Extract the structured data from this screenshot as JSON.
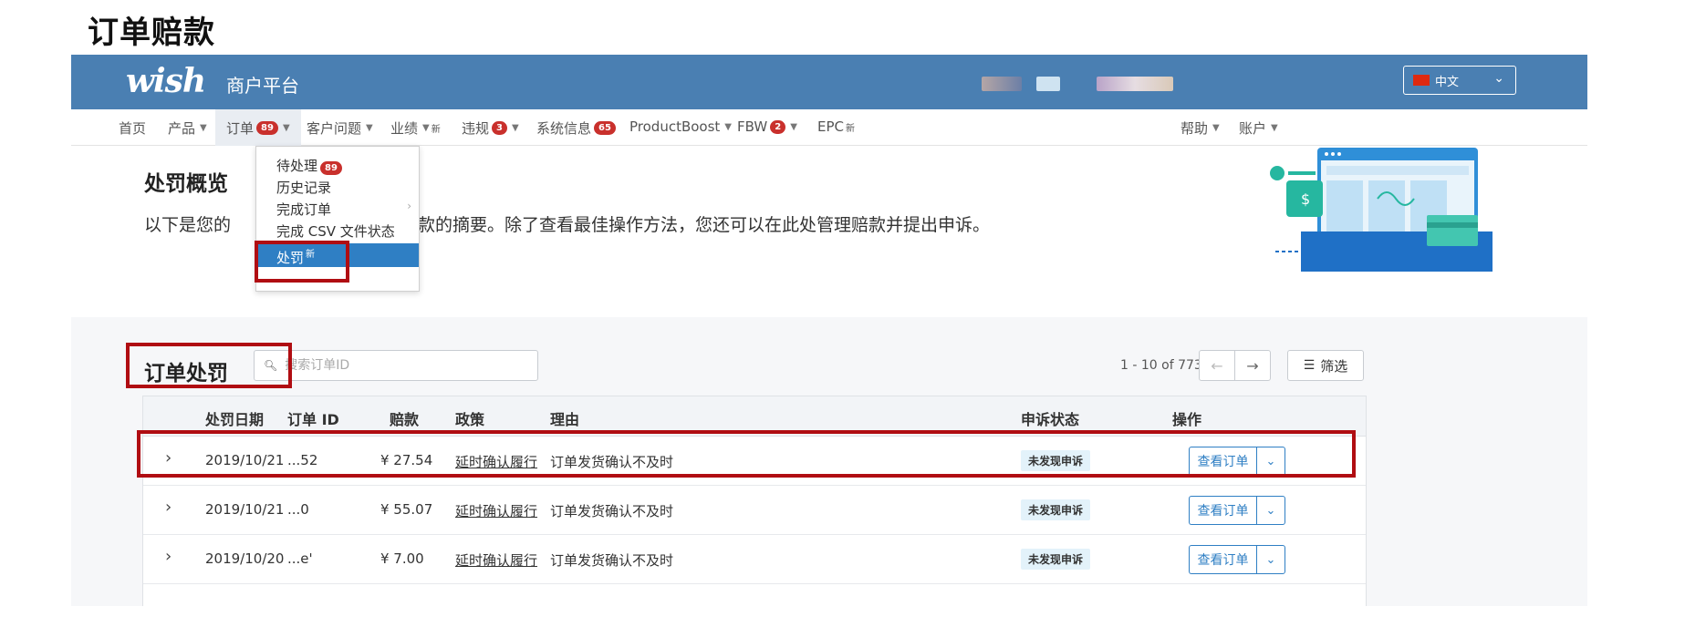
{
  "doc_heading": "订单赔款",
  "header": {
    "logo": "wish",
    "platform": "商户平台",
    "language": "中文",
    "colors": {
      "bar": "#4a7fb2",
      "accent": "#2f7fc4",
      "highlight_box": "#b00d12"
    }
  },
  "nav": {
    "home": "首页",
    "products": "产品",
    "orders": "订单",
    "orders_badge": "89",
    "customer": "客户问题",
    "performance": "业绩",
    "performance_new": "新",
    "violations": "违规",
    "violations_badge": "3",
    "system": "系统信息",
    "system_badge": "65",
    "productboost": "ProductBoost",
    "fbw": "FBW",
    "fbw_badge": "2",
    "epc": "EPC",
    "epc_new": "新",
    "help": "帮助",
    "account": "账户"
  },
  "orders_menu": {
    "pending": "待处理",
    "pending_badge": "89",
    "history": "历史记录",
    "completed": "完成订单",
    "csv_status": "完成 CSV 文件状态",
    "penalty": "处罚",
    "penalty_new": "新"
  },
  "overview": {
    "title": "处罚概览",
    "desc_left": "以下是您的",
    "desc_right": "处以赔款的摘要。除了查看最佳操作方法，您还可以在此处管理赔款并提出申诉。"
  },
  "penalties": {
    "title": "订单处罚",
    "search_placeholder": "搜索订单ID",
    "pagination": "1 - 10 of 773",
    "filter_label": "筛选",
    "columns": [
      "处罚日期",
      "订单 ID",
      "赔款",
      "政策",
      "理由",
      "申诉状态",
      "操作"
    ],
    "rows": [
      {
        "date": "2019/10/21",
        "order_id": "...52",
        "amount": "¥ 27.54",
        "policy": "延时确认履行",
        "reason": "订单发货确认不及时",
        "appeal": "未发现申诉",
        "view": "查看订单"
      },
      {
        "date": "2019/10/21",
        "order_id": "...0",
        "amount": "¥ 55.07",
        "policy": "延时确认履行",
        "reason": "订单发货确认不及时",
        "appeal": "未发现申诉",
        "view": "查看订单"
      },
      {
        "date": "2019/10/20",
        "order_id": "...e'",
        "amount": "¥ 7.00",
        "policy": "延时确认履行",
        "reason": "订单发货确认不及时",
        "appeal": "未发现申诉",
        "view": "查看订单"
      }
    ]
  },
  "icons": {
    "search": "search-icon",
    "filter": "filter-icon",
    "expand": "chevron-right-icon",
    "dropdown": "chevron-down-icon"
  }
}
